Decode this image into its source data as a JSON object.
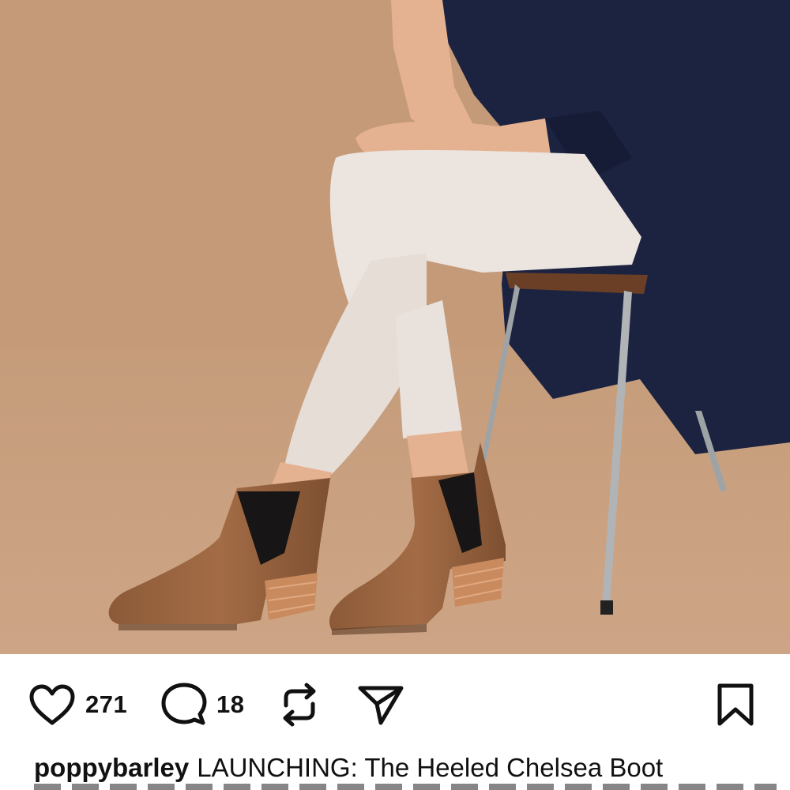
{
  "post": {
    "image": {
      "icon": "product-photo",
      "colors": {
        "backdrop": "#c69c7b",
        "jacket": "#1b2340",
        "jeans": "#ece4df",
        "boot": "#9a6540",
        "heel": "#c98a5e"
      }
    },
    "actions": {
      "like": {
        "icon": "heart-icon",
        "count": "271"
      },
      "comment": {
        "icon": "comment-icon",
        "count": "18"
      },
      "repost": {
        "icon": "repost-icon"
      },
      "send": {
        "icon": "send-icon"
      },
      "save": {
        "icon": "bookmark-icon"
      }
    },
    "caption": {
      "username": "poppybarley",
      "text": "LAUNCHING: The Heeled Chelsea Boot"
    }
  }
}
